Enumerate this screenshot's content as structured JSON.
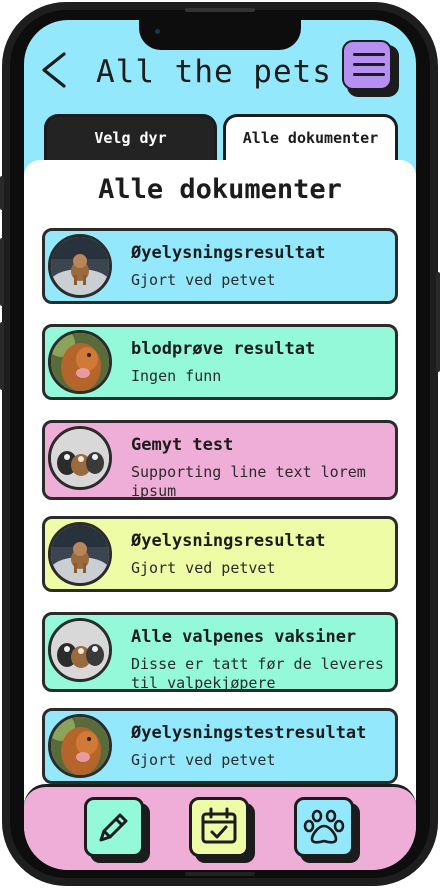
{
  "header": {
    "title": "All the pets"
  },
  "tabs": [
    {
      "label": "Velg dyr",
      "active": false
    },
    {
      "label": "Alle dokumenter",
      "active": true
    }
  ],
  "panel": {
    "title": "Alle dokumenter"
  },
  "documents": [
    {
      "title": "Øyelysningsresultat",
      "subtitle": "Gjort ved petvet",
      "color": "#94e8fb",
      "avatar": "puppy-running-photo"
    },
    {
      "title": "blodprøve resultat",
      "subtitle": "Ingen funn",
      "color": "#94f9d9",
      "avatar": "dog-portrait-photo"
    },
    {
      "title": "Gemyt test",
      "subtitle": "Supporting line text lorem ipsum",
      "color": "#efaed8",
      "avatar": "puppies-group-photo"
    },
    {
      "title": "Øyelysningsresultat",
      "subtitle": "Gjort ved petvet",
      "color": "#eefca6",
      "avatar": "puppy-running-photo"
    },
    {
      "title": "Alle valpenes vaksiner",
      "subtitle": "Disse er tatt før de leveres til valpekjøpere",
      "color": "#94f9d9",
      "avatar": "puppies-group-photo"
    },
    {
      "title": "Øyelysningstestresultat",
      "subtitle": "Gjort ved petvet",
      "color": "#94e8fb",
      "avatar": "dog-portrait-photo"
    }
  ],
  "bottom_nav": [
    {
      "icon": "pencil-icon",
      "color": "#94f9d9"
    },
    {
      "icon": "calendar-check-icon",
      "color": "#eefca6"
    },
    {
      "icon": "paw-icon",
      "color": "#94e8fb"
    }
  ]
}
